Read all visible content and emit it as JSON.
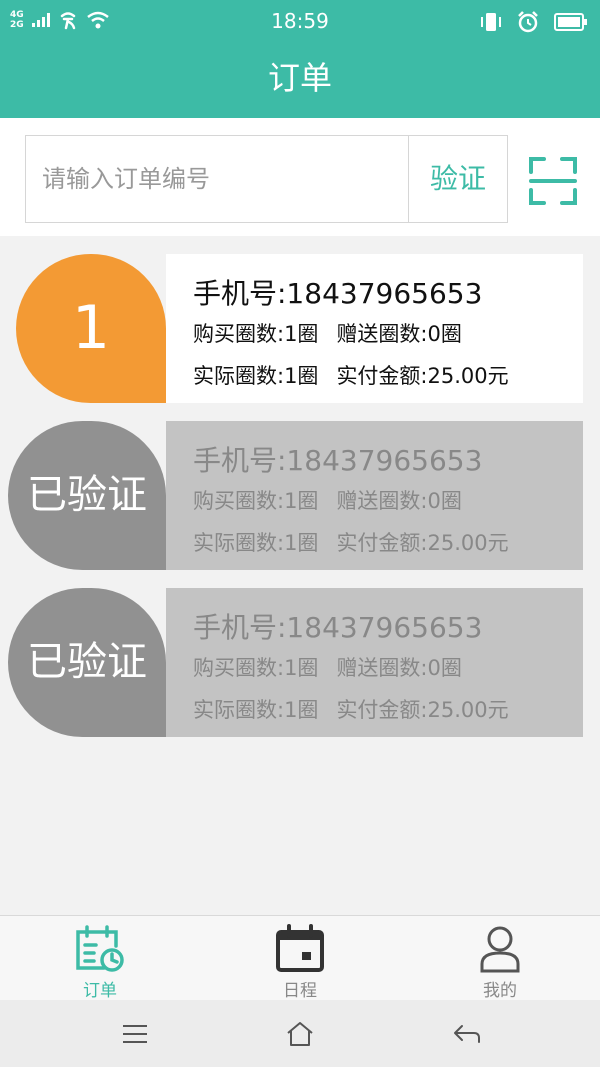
{
  "status_bar": {
    "network": [
      "4G",
      "2G"
    ],
    "time": "18:59",
    "icons": [
      "signal-icon",
      "carrier-icon",
      "wifi-icon",
      "vibrate-icon",
      "alarm-icon",
      "battery-icon"
    ]
  },
  "header": {
    "title": "订单"
  },
  "search": {
    "placeholder": "请输入订单编号",
    "verify_label": "验证",
    "scan_icon": "scan-icon"
  },
  "orders": [
    {
      "badge": "1",
      "phone": "手机号:18437965653",
      "bought": "购买圈数:1圈",
      "gift": "赠送圈数:0圈",
      "actual": "实际圈数:1圈",
      "paid": "实付金额:25.00元",
      "status": "pending"
    },
    {
      "badge": "已验证",
      "phone": "手机号:18437965653",
      "bought": "购买圈数:1圈",
      "gift": "赠送圈数:0圈",
      "actual": "实际圈数:1圈",
      "paid": "实付金额:25.00元",
      "status": "verified"
    },
    {
      "badge": "已验证",
      "phone": "手机号:18437965653",
      "bought": "购买圈数:1圈",
      "gift": "赠送圈数:0圈",
      "actual": "实际圈数:1圈",
      "paid": "实付金额:25.00元",
      "status": "verified"
    }
  ],
  "tabs": [
    {
      "label": "订单",
      "icon": "order-calendar-icon",
      "active": true
    },
    {
      "label": "日程",
      "icon": "calendar-icon",
      "active": false
    },
    {
      "label": "我的",
      "icon": "user-icon",
      "active": false
    }
  ],
  "nav_bar": {
    "icons": [
      "menu-icon",
      "home-icon",
      "back-icon"
    ]
  },
  "colors": {
    "primary": "#3dbba6",
    "badge_active": "#f39a34",
    "badge_done": "#919191",
    "card_done": "#c3c3c3"
  }
}
